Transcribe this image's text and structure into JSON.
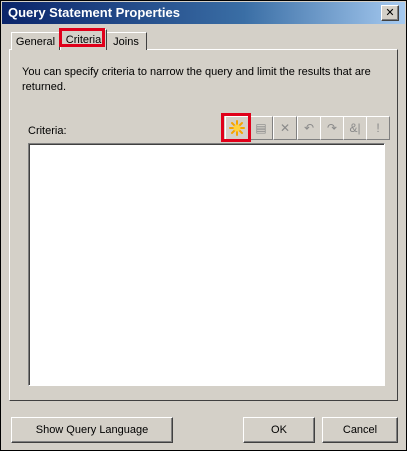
{
  "window": {
    "title": "Query Statement Properties",
    "close_label": "✕"
  },
  "tabs": [
    {
      "label": "General",
      "active": false
    },
    {
      "label": "Criteria",
      "active": true
    },
    {
      "label": "Joins",
      "active": false
    }
  ],
  "criteria_tab": {
    "description": "You can specify criteria to narrow the query and limit the results that are returned.",
    "criteria_label": "Criteria:",
    "toolbar": [
      {
        "icon": "new-criterion-icon",
        "glyph": "✸",
        "enabled": true
      },
      {
        "icon": "properties-icon",
        "glyph": "▤",
        "enabled": false
      },
      {
        "icon": "delete-icon",
        "glyph": "✕",
        "enabled": false
      },
      {
        "icon": "undo-icon",
        "glyph": "↶",
        "enabled": false
      },
      {
        "icon": "redo-icon",
        "glyph": "↷",
        "enabled": false
      },
      {
        "icon": "and-icon",
        "glyph": "&|",
        "enabled": false
      },
      {
        "icon": "not-icon",
        "glyph": "!",
        "enabled": false
      }
    ],
    "criteria_items": []
  },
  "buttons": {
    "show_query_language": "Show Query Language",
    "ok": "OK",
    "cancel": "Cancel"
  },
  "colors": {
    "title_start": "#0a246a",
    "title_end": "#a6caf0",
    "highlight": "#e0001a",
    "dialog_bg": "#d4d0c8",
    "new_icon": "#f5a400"
  }
}
